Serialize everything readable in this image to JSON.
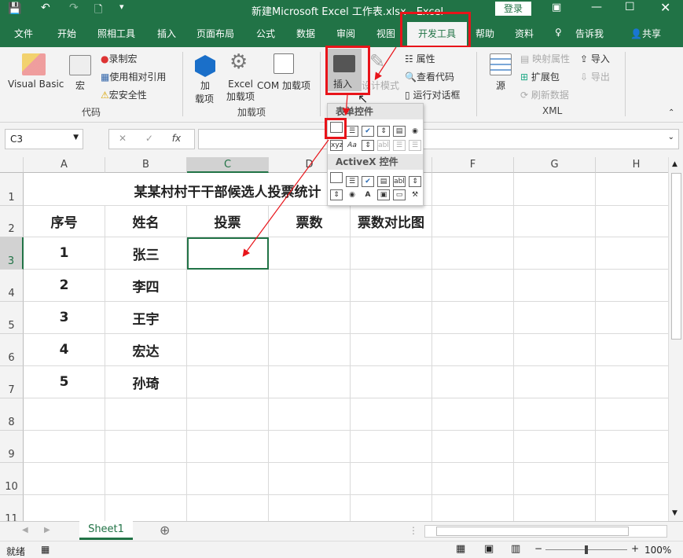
{
  "titlebar": {
    "title": "新建Microsoft Excel 工作表.xlsx  -  Excel",
    "login": "登录"
  },
  "tabs": [
    "文件",
    "开始",
    "照相工具",
    "插入",
    "页面布局",
    "公式",
    "数据",
    "审阅",
    "视图",
    "开发工具",
    "帮助",
    "资料",
    "告诉我",
    "共享"
  ],
  "ribbon": {
    "code": {
      "visual_basic": "Visual Basic",
      "macro": "宏",
      "record": "录制宏",
      "relative": "使用相对引用",
      "security": "宏安全性",
      "group": "代码"
    },
    "addins": {
      "addin1": "加",
      "addin2": "载项",
      "excel1": "Excel",
      "excel2": "加载项",
      "com": "COM 加载项",
      "group": "加载项"
    },
    "controls": {
      "insert": "插入",
      "design": "设计模式",
      "props": "属性",
      "viewcode": "查看代码",
      "dialog": "运行对话框"
    },
    "xml": {
      "source": "源",
      "mapprops": "映射属性",
      "expand": "扩展包",
      "refresh": "刷新数据",
      "import": "导入",
      "export": "导出",
      "group": "XML"
    }
  },
  "popup": {
    "form_controls": "表单控件",
    "activex": "ActiveX 控件"
  },
  "formula": {
    "namebox": "C3",
    "fx": "fx"
  },
  "columns": [
    "A",
    "B",
    "C",
    "D",
    "E",
    "F",
    "G",
    "H"
  ],
  "rows": [
    "1",
    "2",
    "3",
    "4",
    "5",
    "6",
    "7",
    "8",
    "9",
    "10",
    "11"
  ],
  "sheet": {
    "title": "某某村村干干部候选人投票统计",
    "headers": [
      "序号",
      "姓名",
      "投票",
      "票数",
      "票数对比图"
    ],
    "data": [
      [
        "1",
        "张三"
      ],
      [
        "2",
        "李四"
      ],
      [
        "3",
        "王宇"
      ],
      [
        "4",
        "宏达"
      ],
      [
        "5",
        "孙琦"
      ]
    ]
  },
  "sheet_tabs": [
    "Sheet1"
  ],
  "status": {
    "ready": "就绪",
    "zoom": "100%"
  },
  "colors": {
    "accent": "#217346",
    "highlight": "#e8141a"
  }
}
